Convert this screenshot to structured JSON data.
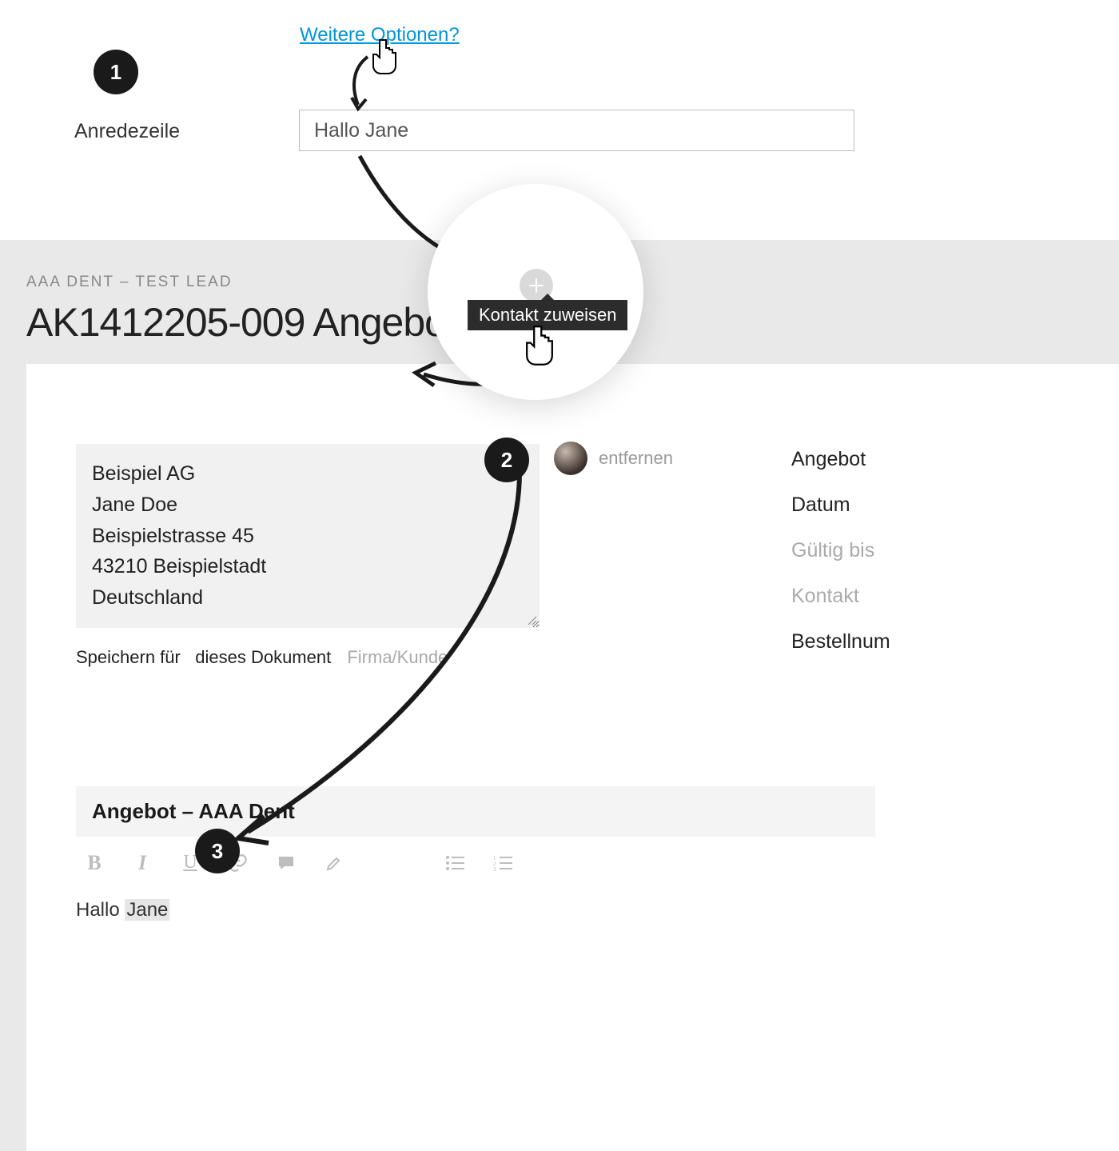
{
  "top": {
    "more_options": "Weitere Optionen?",
    "salutation_label": "Anredezeile",
    "salutation_value": "Hallo Jane"
  },
  "tooltip": {
    "assign_contact": "Kontakt zuweisen"
  },
  "lead": {
    "label": "AAA DENT – TEST LEAD",
    "title": "AK1412205-009 Angebot -"
  },
  "address": {
    "line1": "Beispiel AG",
    "line2": "Jane Doe",
    "line3": "Beispielstrasse 45",
    "line4": "43210 Beispielstadt",
    "line5": "Deutschland"
  },
  "save_for": {
    "prefix": "Speichern für",
    "this_doc": "dieses Dokument",
    "company": "Firma/Kunde"
  },
  "contact": {
    "remove": "entfernen"
  },
  "meta": {
    "offer": "Angebot",
    "date": "Datum",
    "valid_until": "Gültig bis",
    "contact": "Kontakt",
    "order": "Bestellnum"
  },
  "editor": {
    "subject": "Angebot – AAA Dent",
    "greeting_prefix": "Hallo ",
    "greeting_name": "Jane"
  },
  "steps": {
    "one": "1",
    "two": "2",
    "three": "3"
  }
}
